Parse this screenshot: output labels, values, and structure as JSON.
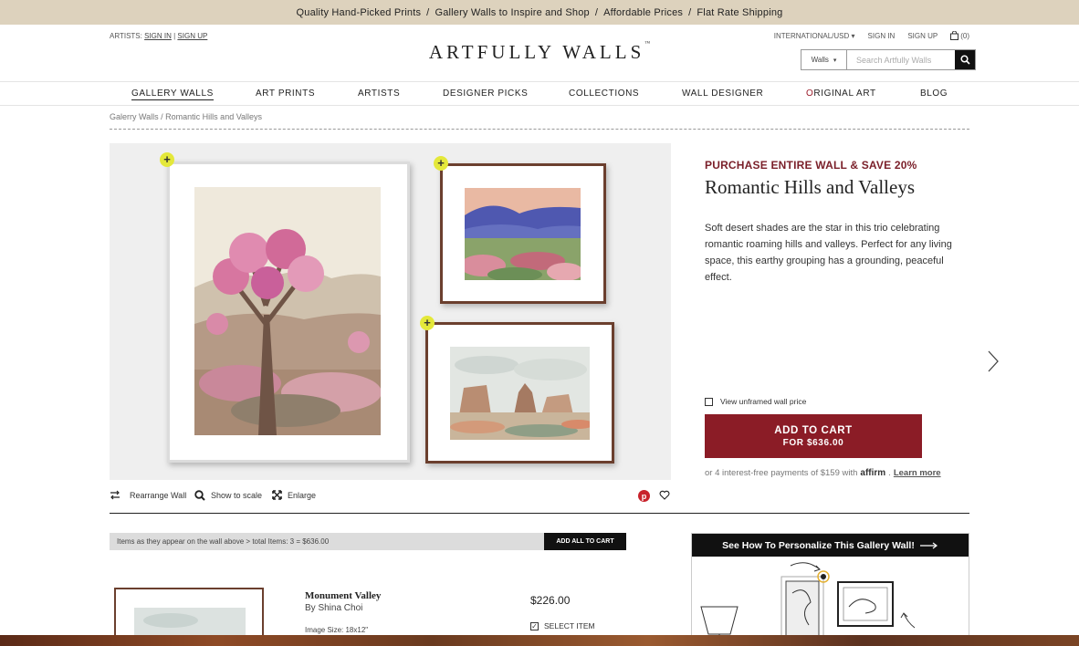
{
  "promo": {
    "items": [
      "Quality Hand-Picked Prints",
      "Gallery Walls to Inspire and Shop",
      "Affordable Prices",
      "Flat Rate Shipping"
    ],
    "separator": "/"
  },
  "header": {
    "artists_label": "ARTISTS:",
    "artists_sign_in": "SIGN IN",
    "artists_sep": "|",
    "artists_sign_up": "SIGN UP",
    "region": "INTERNATIONAL/USD",
    "sign_in": "SIGN IN",
    "sign_up": "SIGN UP",
    "cart_count": "(0)",
    "logo": "ARTFULLY WALLS",
    "logo_tm": "™",
    "search_category": "Walls",
    "search_placeholder": "Search Artfully Walls"
  },
  "nav": {
    "items": [
      {
        "label": "GALLERY WALLS"
      },
      {
        "label": "ART PRINTS"
      },
      {
        "label": "ARTISTS"
      },
      {
        "label": "DESIGNER PICKS"
      },
      {
        "label": "COLLECTIONS"
      },
      {
        "label": "WALL DESIGNER"
      },
      {
        "label_first": "O",
        "label_rest": "RIGINAL ART"
      },
      {
        "label": "BLOG"
      }
    ]
  },
  "breadcrumb": "Galerry Walls / Romantic Hills and Valleys",
  "tools": {
    "rearrange": "Rearrange Wall",
    "show_scale": "Show to scale",
    "enlarge": "Enlarge"
  },
  "product": {
    "headline": "PURCHASE ENTIRE WALL & SAVE 20%",
    "title": "Romantic Hills and Valleys",
    "description": "Soft desert shades are the star in this trio celebrating romantic roaming hills and valleys. Perfect for any living space, this earthy grouping has a grounding, peaceful effect.",
    "unframed_label": "View unframed wall price",
    "add_cart_line1": "ADD TO CART",
    "add_cart_line2": "FOR $636.00",
    "affirm_prefix": "or 4 interest-free payments of $159 with",
    "affirm_brand": "affirm",
    "affirm_learn": "Learn more"
  },
  "items_list": {
    "summary": "Items as they appear on the wall above > total Items: 3 = $636.00",
    "add_all": "ADD ALL TO CART",
    "items": [
      {
        "name": "Monument Valley",
        "artist": "By Shina Choi",
        "size": "Image Size: 18x12\"",
        "price": "$226.00",
        "select_label": "SELECT ITEM"
      }
    ]
  },
  "personalize": {
    "title": "See How To Personalize This Gallery Wall!"
  },
  "colors": {
    "promo_bg": "#ddd2bd",
    "accent_red": "#8b1c26",
    "plus_yellow": "#e4e83a",
    "frame_wood": "#6b3f2e"
  }
}
